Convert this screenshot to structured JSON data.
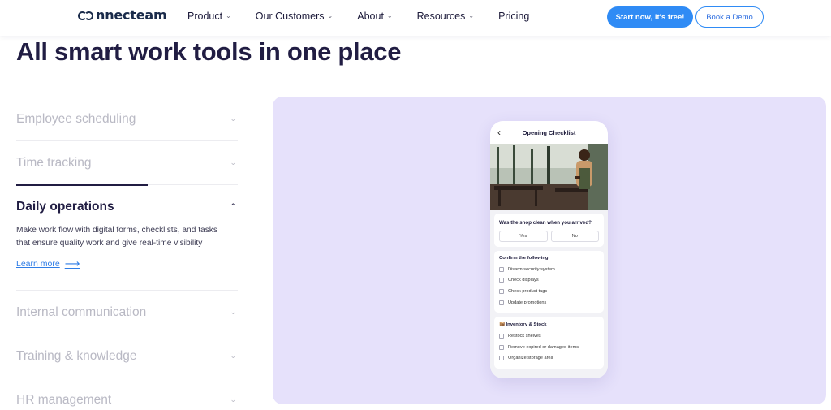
{
  "header": {
    "logo": "connecteam",
    "nav": [
      {
        "label": "Product",
        "dropdown": true
      },
      {
        "label": "Our Customers",
        "dropdown": true
      },
      {
        "label": "About",
        "dropdown": true
      },
      {
        "label": "Resources",
        "dropdown": true
      },
      {
        "label": "Pricing",
        "dropdown": false
      }
    ],
    "cta_primary": "Start now, it's free!",
    "cta_secondary": "Book a Demo"
  },
  "page_title": "All smart work tools in one place",
  "accordion": [
    {
      "label": "Employee scheduling",
      "state": "collapsed"
    },
    {
      "label": "Time tracking",
      "state": "collapsed"
    },
    {
      "label": "Daily operations",
      "state": "expanded",
      "description": "Make work flow with digital forms, checklists, and tasks that ensure quality work and give real-time visibility",
      "link": "Learn more"
    },
    {
      "label": "Internal communication",
      "state": "collapsed"
    },
    {
      "label": "Training & knowledge",
      "state": "collapsed"
    },
    {
      "label": "HR management",
      "state": "collapsed"
    }
  ],
  "phone": {
    "title": "Opening Checklist",
    "question": "Was the shop clean when you arrived?",
    "answers": [
      "Yes",
      "No"
    ],
    "confirm_title": "Confirm the following",
    "confirm_items": [
      "Disarm security system",
      "Check displays",
      "Check product tags",
      "Update promotions"
    ],
    "inventory_title": "Inventory & Stock",
    "inventory_items": [
      "Restock shelves",
      "Remove expired or damaged items",
      "Organize storage area"
    ]
  },
  "colors": {
    "brand_navy": "#1a2b4a",
    "accent_blue": "#2f8bf5",
    "panel_lavender": "#e6e1fb",
    "heading": "#211d43"
  }
}
